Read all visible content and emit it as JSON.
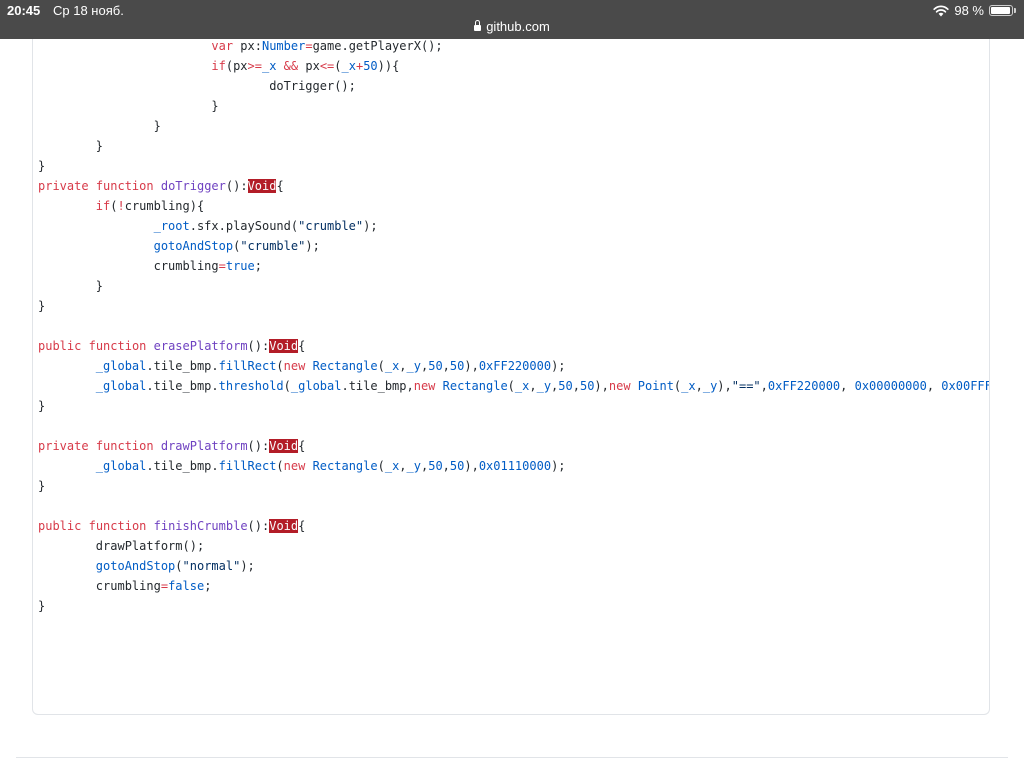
{
  "statusbar": {
    "time": "20:45",
    "date": "Ср 18 нояб.",
    "url": "github.com",
    "battery": "98 %",
    "icons": [
      "lock-icon",
      "wifi-icon",
      "battery-icon"
    ]
  },
  "code": {
    "lines": [
      [
        [
          "t",
          "\t\t\t"
        ],
        [
          "k",
          "var"
        ],
        [
          "t",
          " px:"
        ],
        [
          "c",
          "Number"
        ],
        [
          "k",
          "="
        ],
        [
          "t",
          "game.getPlayerX();"
        ]
      ],
      [
        [
          "t",
          "\t\t\t"
        ],
        [
          "k",
          "if"
        ],
        [
          "t",
          "(px"
        ],
        [
          "k",
          ">="
        ],
        [
          "c",
          "_x"
        ],
        [
          "t",
          " "
        ],
        [
          "k",
          "&&"
        ],
        [
          "t",
          " px"
        ],
        [
          "k",
          "<="
        ],
        [
          "t",
          "("
        ],
        [
          "c",
          "_x"
        ],
        [
          "k",
          "+"
        ],
        [
          "c",
          "50"
        ],
        [
          "t",
          "))"
        ],
        [
          "t",
          "{"
        ]
      ],
      [
        [
          "t",
          "\t\t\t\tdoTrigger();"
        ]
      ],
      [
        [
          "t",
          "\t\t\t}"
        ]
      ],
      [
        [
          "t",
          "\t\t}"
        ]
      ],
      [
        [
          "t",
          "\t}"
        ]
      ],
      [
        [
          "t",
          "}"
        ]
      ],
      [
        [
          "k",
          "private"
        ],
        [
          "t",
          " "
        ],
        [
          "k",
          "function"
        ],
        [
          "t",
          " "
        ],
        [
          "f",
          "doTrigger"
        ],
        [
          "t",
          "():"
        ],
        [
          "v",
          "Void"
        ],
        [
          "t",
          "{"
        ]
      ],
      [
        [
          "t",
          "\t"
        ],
        [
          "k",
          "if"
        ],
        [
          "t",
          "("
        ],
        [
          "k",
          "!"
        ],
        [
          "t",
          "crumbling){"
        ]
      ],
      [
        [
          "t",
          "\t\t"
        ],
        [
          "c",
          "_root"
        ],
        [
          "t",
          ".sfx.playSound("
        ],
        [
          "s",
          "\"crumble\""
        ],
        [
          "t",
          ");"
        ]
      ],
      [
        [
          "t",
          "\t\t"
        ],
        [
          "c",
          "gotoAndStop"
        ],
        [
          "t",
          "("
        ],
        [
          "s",
          "\"crumble\""
        ],
        [
          "t",
          ");"
        ]
      ],
      [
        [
          "t",
          "\t\tcrumbling"
        ],
        [
          "k",
          "="
        ],
        [
          "c",
          "true"
        ],
        [
          "t",
          ";"
        ]
      ],
      [
        [
          "t",
          "\t}"
        ]
      ],
      [
        [
          "t",
          "}"
        ]
      ],
      [
        [
          "t",
          ""
        ]
      ],
      [
        [
          "k",
          "public"
        ],
        [
          "t",
          " "
        ],
        [
          "k",
          "function"
        ],
        [
          "t",
          " "
        ],
        [
          "f",
          "erasePlatform"
        ],
        [
          "t",
          "():"
        ],
        [
          "v",
          "Void"
        ],
        [
          "t",
          "{"
        ]
      ],
      [
        [
          "t",
          "\t"
        ],
        [
          "c",
          "_global"
        ],
        [
          "t",
          ".tile_bmp."
        ],
        [
          "c",
          "fillRect"
        ],
        [
          "t",
          "("
        ],
        [
          "k",
          "new"
        ],
        [
          "t",
          " "
        ],
        [
          "c",
          "Rectangle"
        ],
        [
          "t",
          "("
        ],
        [
          "c",
          "_x"
        ],
        [
          "t",
          ","
        ],
        [
          "c",
          "_y"
        ],
        [
          "t",
          ","
        ],
        [
          "c",
          "50"
        ],
        [
          "t",
          ","
        ],
        [
          "c",
          "50"
        ],
        [
          "t",
          "),"
        ],
        [
          "c",
          "0xFF220000"
        ],
        [
          "t",
          ");"
        ]
      ],
      [
        [
          "t",
          "\t"
        ],
        [
          "c",
          "_global"
        ],
        [
          "t",
          ".tile_bmp."
        ],
        [
          "c",
          "threshold"
        ],
        [
          "t",
          "("
        ],
        [
          "c",
          "_global"
        ],
        [
          "t",
          ".tile_bmp,"
        ],
        [
          "k",
          "new"
        ],
        [
          "t",
          " "
        ],
        [
          "c",
          "Rectangle"
        ],
        [
          "t",
          "("
        ],
        [
          "c",
          "_x"
        ],
        [
          "t",
          ","
        ],
        [
          "c",
          "_y"
        ],
        [
          "t",
          ","
        ],
        [
          "c",
          "50"
        ],
        [
          "t",
          ","
        ],
        [
          "c",
          "50"
        ],
        [
          "t",
          "),"
        ],
        [
          "k",
          "new"
        ],
        [
          "t",
          " "
        ],
        [
          "c",
          "Point"
        ],
        [
          "t",
          "("
        ],
        [
          "c",
          "_x"
        ],
        [
          "t",
          ","
        ],
        [
          "c",
          "_y"
        ],
        [
          "t",
          "),"
        ],
        [
          "s",
          "\"==\""
        ],
        [
          "t",
          ","
        ],
        [
          "c",
          "0xFF220000"
        ],
        [
          "t",
          ", "
        ],
        [
          "c",
          "0x00000000"
        ],
        [
          "t",
          ", "
        ],
        [
          "c",
          "0x00FFF"
        ]
      ],
      [
        [
          "t",
          "}"
        ]
      ],
      [
        [
          "t",
          ""
        ]
      ],
      [
        [
          "k",
          "private"
        ],
        [
          "t",
          " "
        ],
        [
          "k",
          "function"
        ],
        [
          "t",
          " "
        ],
        [
          "f",
          "drawPlatform"
        ],
        [
          "t",
          "():"
        ],
        [
          "v",
          "Void"
        ],
        [
          "t",
          "{"
        ]
      ],
      [
        [
          "t",
          "\t"
        ],
        [
          "c",
          "_global"
        ],
        [
          "t",
          ".tile_bmp."
        ],
        [
          "c",
          "fillRect"
        ],
        [
          "t",
          "("
        ],
        [
          "k",
          "new"
        ],
        [
          "t",
          " "
        ],
        [
          "c",
          "Rectangle"
        ],
        [
          "t",
          "("
        ],
        [
          "c",
          "_x"
        ],
        [
          "t",
          ","
        ],
        [
          "c",
          "_y"
        ],
        [
          "t",
          ","
        ],
        [
          "c",
          "50"
        ],
        [
          "t",
          ","
        ],
        [
          "c",
          "50"
        ],
        [
          "t",
          "),"
        ],
        [
          "c",
          "0x01110000"
        ],
        [
          "t",
          ");"
        ]
      ],
      [
        [
          "t",
          "}"
        ]
      ],
      [
        [
          "t",
          ""
        ]
      ],
      [
        [
          "k",
          "public"
        ],
        [
          "t",
          " "
        ],
        [
          "k",
          "function"
        ],
        [
          "t",
          " "
        ],
        [
          "f",
          "finishCrumble"
        ],
        [
          "t",
          "():"
        ],
        [
          "v",
          "Void"
        ],
        [
          "t",
          "{"
        ]
      ],
      [
        [
          "t",
          "\tdrawPlatform();"
        ]
      ],
      [
        [
          "t",
          "\t"
        ],
        [
          "c",
          "gotoAndStop"
        ],
        [
          "t",
          "("
        ],
        [
          "s",
          "\"normal\""
        ],
        [
          "t",
          ");"
        ]
      ],
      [
        [
          "t",
          "\tcrumbling"
        ],
        [
          "k",
          "="
        ],
        [
          "c",
          "false"
        ],
        [
          "t",
          ";"
        ]
      ],
      [
        [
          "t",
          "}"
        ]
      ]
    ]
  }
}
